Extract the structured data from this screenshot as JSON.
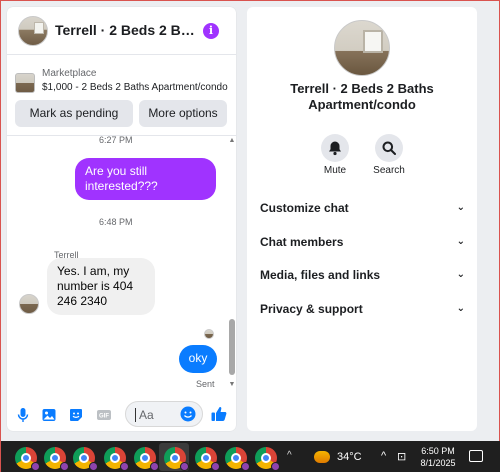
{
  "chat": {
    "title": "Terrell · 2 Beds 2 Bath…",
    "listing_category": "Marketplace",
    "listing_description": "$1,000 - 2 Beds 2 Baths Apartment/condo",
    "mark_pending_label": "Mark as pending",
    "more_options_label": "More options",
    "messages": [
      {
        "type": "time",
        "text": "6:27 PM"
      },
      {
        "type": "outgoing",
        "text": "Are you still interested???"
      },
      {
        "type": "time",
        "text": "6:48 PM"
      },
      {
        "type": "sender",
        "text": "Terrell"
      },
      {
        "type": "incoming",
        "text": "Yes. I am, my number is 404 246 2340"
      },
      {
        "type": "outgoing",
        "text": "oky"
      }
    ],
    "status": "Sent",
    "composer_placeholder": "Aa",
    "accent_color": "#a033ff"
  },
  "info_panel": {
    "name": "Terrell · 2 Beds 2 Baths Apartment/condo",
    "actions": [
      {
        "icon": "bell-icon",
        "label": "Mute"
      },
      {
        "icon": "search-icon",
        "label": "Search"
      }
    ],
    "menu": [
      "Customize chat",
      "Chat members",
      "Media, files and links",
      "Privacy & support"
    ]
  },
  "taskbar": {
    "apps": [
      "chrome-icon",
      "chrome-icon",
      "chrome-icon",
      "chrome-icon",
      "chrome-icon",
      "chrome-icon",
      "chrome-icon",
      "chrome-icon",
      "chrome-icon",
      "chrome-icon",
      "chrome-icon"
    ],
    "temperature": "34°C",
    "time": "6:50 PM",
    "date": "8/1/2025"
  }
}
